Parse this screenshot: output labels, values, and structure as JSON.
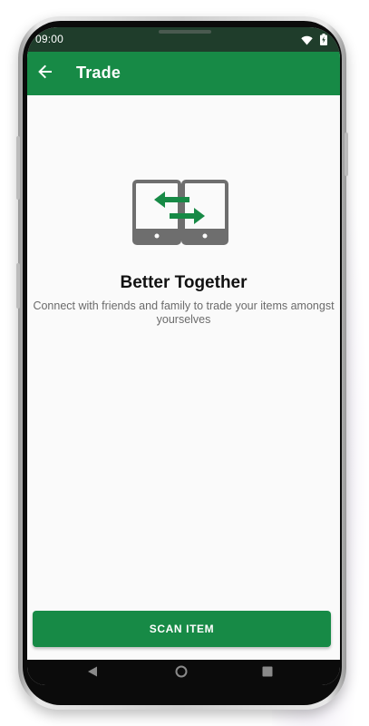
{
  "status_bar": {
    "time": "09:00",
    "icons": [
      "wifi-icon",
      "battery-charging-icon"
    ]
  },
  "app_bar": {
    "back_icon": "arrow-left-icon",
    "title": "Trade"
  },
  "hero": {
    "icon": "phones-exchange-icon",
    "headline": "Better Together",
    "description": "Connect with friends and family to trade your items amongst yourselves"
  },
  "actions": {
    "scan_label": "SCAN ITEM"
  },
  "nav_bar": {
    "buttons": [
      "back-triangle-icon",
      "home-circle-icon",
      "recents-square-icon"
    ]
  },
  "colors": {
    "primary": "#178a46",
    "status_bar": "#1f3d2b",
    "background": "#fafafa",
    "icon_gray": "#6e6e6e"
  }
}
